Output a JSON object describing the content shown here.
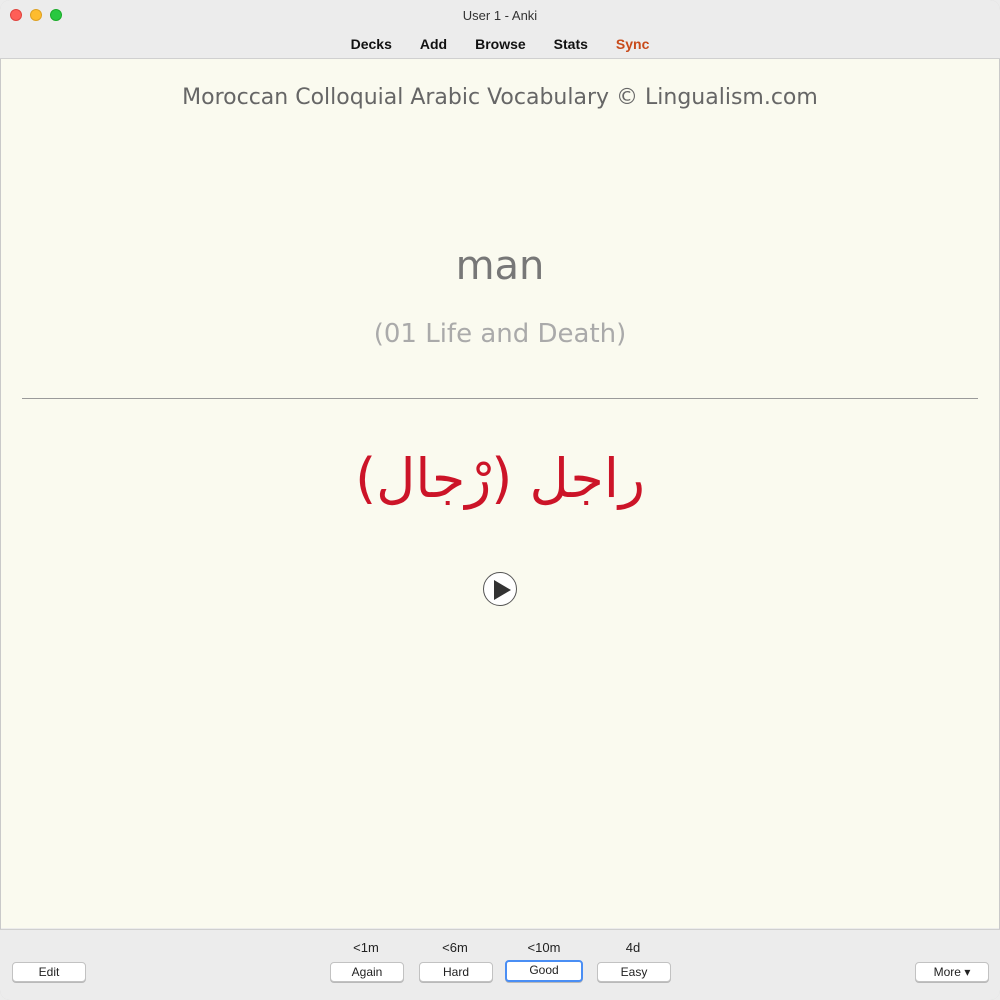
{
  "window": {
    "title": "User 1 - Anki"
  },
  "toolbar": {
    "items": [
      "Decks",
      "Add",
      "Browse",
      "Stats",
      "Sync"
    ]
  },
  "card": {
    "deck_title": "Moroccan Colloquial Arabic Vocabulary © Lingualism.com",
    "front_word": "man",
    "category": "(01 Life and Death)",
    "arabic": "راجل (رْجال)",
    "arabic_color": "#cc1428"
  },
  "bottom": {
    "edit_label": "Edit",
    "more_label": "More ▾",
    "answers": [
      {
        "interval": "<1m",
        "label": "Again"
      },
      {
        "interval": "<6m",
        "label": "Hard"
      },
      {
        "interval": "<10m",
        "label": "Good"
      },
      {
        "interval": "4d",
        "label": "Easy"
      }
    ]
  }
}
